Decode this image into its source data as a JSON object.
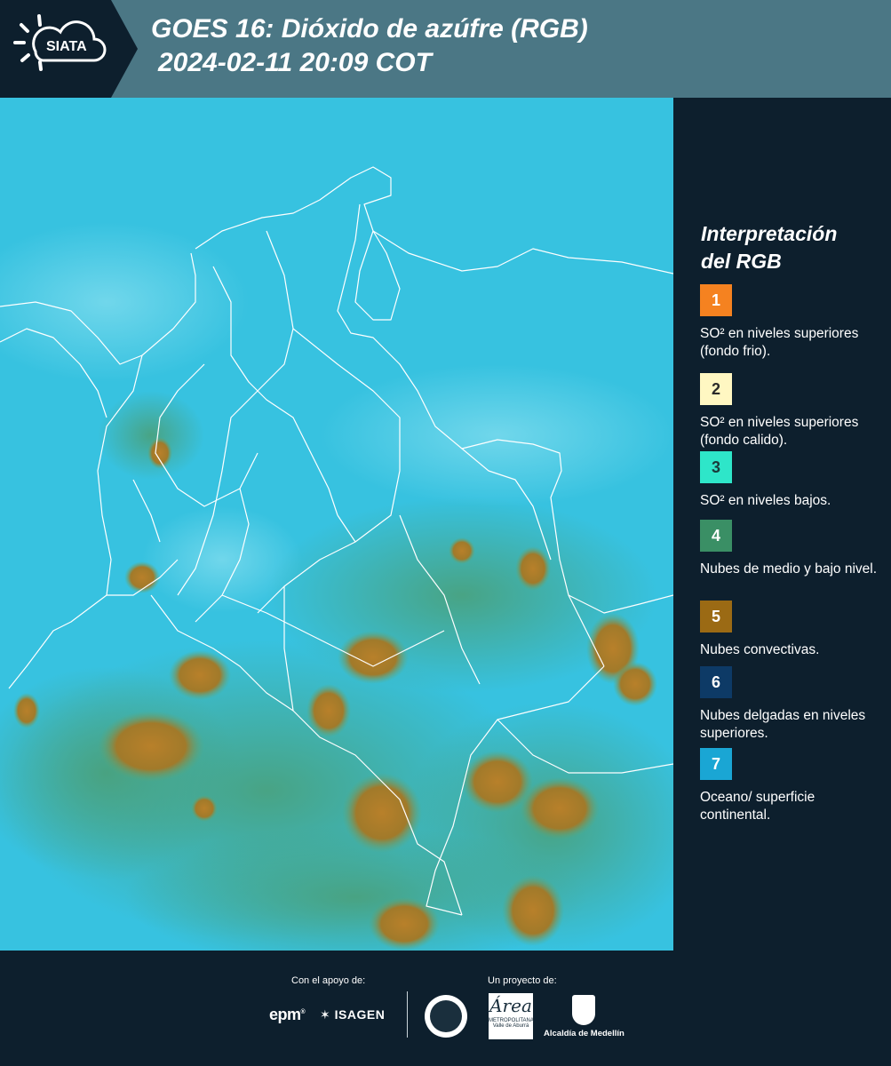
{
  "header": {
    "brand": "SIATA",
    "title_line1": "GOES 16: Dióxido de azúfre (RGB)",
    "title_line2": "2024-02-11 20:09 COT",
    "colors": {
      "band": "#4b7785",
      "logo_tab": "#0d1f2d"
    }
  },
  "legend": {
    "title_line1": "Interpretación",
    "title_line2": "del RGB",
    "items": [
      {
        "number": "1",
        "text": "SO² en niveles superiores (fondo frio).",
        "color": "#f58220",
        "text_color": "#ffffff"
      },
      {
        "number": "2",
        "text": "SO² en niveles superiores (fondo calido).",
        "color": "#fff7c2",
        "text_color": "#2a2a2a"
      },
      {
        "number": "3",
        "text": "SO² en niveles bajos.",
        "color": "#2ee6c9",
        "text_color": "#1a3a3a"
      },
      {
        "number": "4",
        "text": "Nubes de medio y bajo nivel.",
        "color": "#3a8f65",
        "text_color": "#ffffff"
      },
      {
        "number": "5",
        "text": "Nubes convectivas.",
        "color": "#9b6a14",
        "text_color": "#ffffff"
      },
      {
        "number": "6",
        "text": "Nubes delgadas en niveles superiores.",
        "color": "#0d3a66",
        "text_color": "#ffffff"
      },
      {
        "number": "7",
        "text": "Oceano/ superficie continental.",
        "color": "#1aa6d4",
        "text_color": "#ffffff"
      }
    ]
  },
  "footer": {
    "support_label": "Con el apoyo de:",
    "project_label": "Un proyecto de:",
    "sponsors": [
      "epm",
      "ISAGEN"
    ],
    "partners": [
      "Área",
      "METROPOLITANA",
      "Valle de Aburrá",
      "Alcaldía de Medellín"
    ]
  },
  "map": {
    "colors": {
      "ocean_land": "#37c2e0",
      "convective": "#b8802a",
      "mid_low": "#4aa07a",
      "borders": "#ffffff"
    }
  }
}
